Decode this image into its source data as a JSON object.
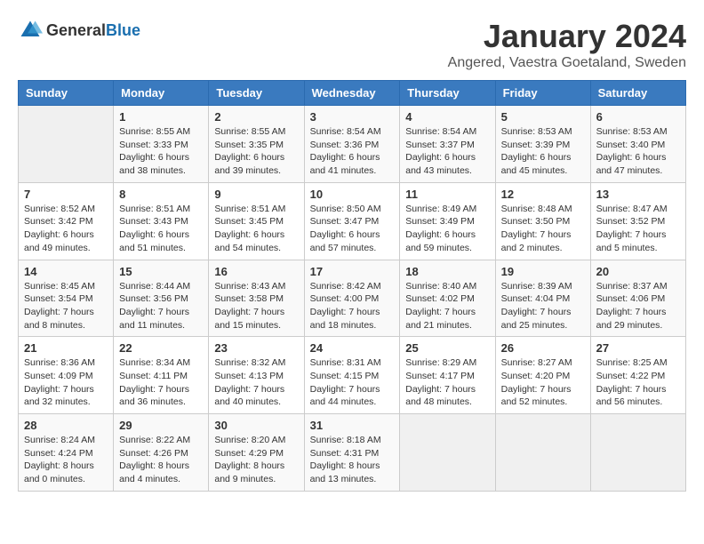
{
  "logo": {
    "text_general": "General",
    "text_blue": "Blue"
  },
  "title": "January 2024",
  "location": "Angered, Vaestra Goetaland, Sweden",
  "days_of_week": [
    "Sunday",
    "Monday",
    "Tuesday",
    "Wednesday",
    "Thursday",
    "Friday",
    "Saturday"
  ],
  "weeks": [
    [
      {
        "day": "",
        "info": ""
      },
      {
        "day": "1",
        "info": "Sunrise: 8:55 AM\nSunset: 3:33 PM\nDaylight: 6 hours\nand 38 minutes."
      },
      {
        "day": "2",
        "info": "Sunrise: 8:55 AM\nSunset: 3:35 PM\nDaylight: 6 hours\nand 39 minutes."
      },
      {
        "day": "3",
        "info": "Sunrise: 8:54 AM\nSunset: 3:36 PM\nDaylight: 6 hours\nand 41 minutes."
      },
      {
        "day": "4",
        "info": "Sunrise: 8:54 AM\nSunset: 3:37 PM\nDaylight: 6 hours\nand 43 minutes."
      },
      {
        "day": "5",
        "info": "Sunrise: 8:53 AM\nSunset: 3:39 PM\nDaylight: 6 hours\nand 45 minutes."
      },
      {
        "day": "6",
        "info": "Sunrise: 8:53 AM\nSunset: 3:40 PM\nDaylight: 6 hours\nand 47 minutes."
      }
    ],
    [
      {
        "day": "7",
        "info": "Sunrise: 8:52 AM\nSunset: 3:42 PM\nDaylight: 6 hours\nand 49 minutes."
      },
      {
        "day": "8",
        "info": "Sunrise: 8:51 AM\nSunset: 3:43 PM\nDaylight: 6 hours\nand 51 minutes."
      },
      {
        "day": "9",
        "info": "Sunrise: 8:51 AM\nSunset: 3:45 PM\nDaylight: 6 hours\nand 54 minutes."
      },
      {
        "day": "10",
        "info": "Sunrise: 8:50 AM\nSunset: 3:47 PM\nDaylight: 6 hours\nand 57 minutes."
      },
      {
        "day": "11",
        "info": "Sunrise: 8:49 AM\nSunset: 3:49 PM\nDaylight: 6 hours\nand 59 minutes."
      },
      {
        "day": "12",
        "info": "Sunrise: 8:48 AM\nSunset: 3:50 PM\nDaylight: 7 hours\nand 2 minutes."
      },
      {
        "day": "13",
        "info": "Sunrise: 8:47 AM\nSunset: 3:52 PM\nDaylight: 7 hours\nand 5 minutes."
      }
    ],
    [
      {
        "day": "14",
        "info": "Sunrise: 8:45 AM\nSunset: 3:54 PM\nDaylight: 7 hours\nand 8 minutes."
      },
      {
        "day": "15",
        "info": "Sunrise: 8:44 AM\nSunset: 3:56 PM\nDaylight: 7 hours\nand 11 minutes."
      },
      {
        "day": "16",
        "info": "Sunrise: 8:43 AM\nSunset: 3:58 PM\nDaylight: 7 hours\nand 15 minutes."
      },
      {
        "day": "17",
        "info": "Sunrise: 8:42 AM\nSunset: 4:00 PM\nDaylight: 7 hours\nand 18 minutes."
      },
      {
        "day": "18",
        "info": "Sunrise: 8:40 AM\nSunset: 4:02 PM\nDaylight: 7 hours\nand 21 minutes."
      },
      {
        "day": "19",
        "info": "Sunrise: 8:39 AM\nSunset: 4:04 PM\nDaylight: 7 hours\nand 25 minutes."
      },
      {
        "day": "20",
        "info": "Sunrise: 8:37 AM\nSunset: 4:06 PM\nDaylight: 7 hours\nand 29 minutes."
      }
    ],
    [
      {
        "day": "21",
        "info": "Sunrise: 8:36 AM\nSunset: 4:09 PM\nDaylight: 7 hours\nand 32 minutes."
      },
      {
        "day": "22",
        "info": "Sunrise: 8:34 AM\nSunset: 4:11 PM\nDaylight: 7 hours\nand 36 minutes."
      },
      {
        "day": "23",
        "info": "Sunrise: 8:32 AM\nSunset: 4:13 PM\nDaylight: 7 hours\nand 40 minutes."
      },
      {
        "day": "24",
        "info": "Sunrise: 8:31 AM\nSunset: 4:15 PM\nDaylight: 7 hours\nand 44 minutes."
      },
      {
        "day": "25",
        "info": "Sunrise: 8:29 AM\nSunset: 4:17 PM\nDaylight: 7 hours\nand 48 minutes."
      },
      {
        "day": "26",
        "info": "Sunrise: 8:27 AM\nSunset: 4:20 PM\nDaylight: 7 hours\nand 52 minutes."
      },
      {
        "day": "27",
        "info": "Sunrise: 8:25 AM\nSunset: 4:22 PM\nDaylight: 7 hours\nand 56 minutes."
      }
    ],
    [
      {
        "day": "28",
        "info": "Sunrise: 8:24 AM\nSunset: 4:24 PM\nDaylight: 8 hours\nand 0 minutes."
      },
      {
        "day": "29",
        "info": "Sunrise: 8:22 AM\nSunset: 4:26 PM\nDaylight: 8 hours\nand 4 minutes."
      },
      {
        "day": "30",
        "info": "Sunrise: 8:20 AM\nSunset: 4:29 PM\nDaylight: 8 hours\nand 9 minutes."
      },
      {
        "day": "31",
        "info": "Sunrise: 8:18 AM\nSunset: 4:31 PM\nDaylight: 8 hours\nand 13 minutes."
      },
      {
        "day": "",
        "info": ""
      },
      {
        "day": "",
        "info": ""
      },
      {
        "day": "",
        "info": ""
      }
    ]
  ]
}
